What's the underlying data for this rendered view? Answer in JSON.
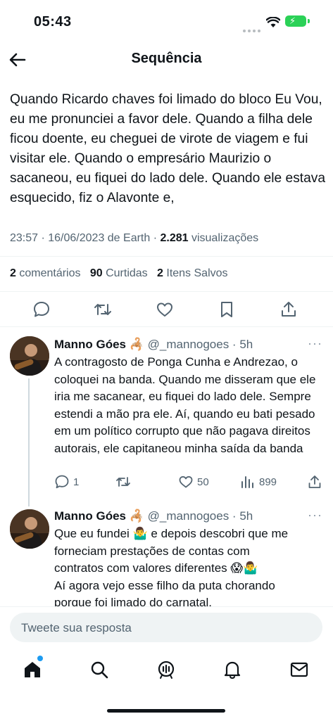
{
  "status": {
    "time": "05:43"
  },
  "header": {
    "title": "Sequência"
  },
  "post": {
    "text": "Quando Ricardo chaves foi limado do bloco Eu Vou, eu me pronunciei a favor dele. Quando a filha dele ficou doente, eu cheguei de virote de viagem e fui visitar ele. Quando o empresário Maurizio o sacaneou, eu fiquei do lado dele. Quando ele estava esquecido, fiz o Alavonte e,",
    "meta_time": "23:57 · 16/06/2023 de Earth · ",
    "views_count": "2.281",
    "views_label": " visualizações",
    "comments_count": "2",
    "comments_label": " comentários",
    "likes_count": "90",
    "likes_label": " Curtidas",
    "saves_count": "2",
    "saves_label": " Itens Salvos"
  },
  "replies": [
    {
      "name": "Manno Góes",
      "emoji": "🦂",
      "handle": "@_mannogoes · 5h",
      "text": "A contragosto de Ponga Cunha e Andrezao, o coloquei na banda. Quando me disseram que ele iria me sacanear, eu fiquei do lado dele. Sempre estendi a mão pra ele. Aí, quando eu bati pesado em um político corrupto que não pagava direitos autorais, ele capitaneou minha saída da banda",
      "reply_count": "1",
      "retweet_count": "",
      "like_count": "50",
      "view_count": "899"
    },
    {
      "name": "Manno Góes",
      "emoji": "🦂",
      "handle": "@_mannogoes · 5h",
      "line1": "Que eu fundei 🤷‍♂️ e depois descobri que me",
      "line2": "forneciam prestações de contas com",
      "line3": "contratos com valores diferentes 😱🤷‍♂️",
      "line4": "Aí agora vejo esse filho da puta chorando",
      "line5": "porque foi limado do carnatal."
    }
  ],
  "composer": {
    "placeholder": "Tweete sua resposta"
  },
  "icons": {
    "back": "arrow-left-icon",
    "reply": "comment-icon",
    "retweet": "retweet-icon",
    "like": "heart-icon",
    "bookmark": "bookmark-icon",
    "share": "share-icon",
    "views": "bar-chart-icon",
    "nav": [
      "home-icon",
      "search-icon",
      "spaces-icon",
      "bell-icon",
      "mail-icon"
    ]
  },
  "colors": {
    "accent": "#1d9bf0",
    "battery": "#2bd157",
    "muted": "#536471"
  }
}
